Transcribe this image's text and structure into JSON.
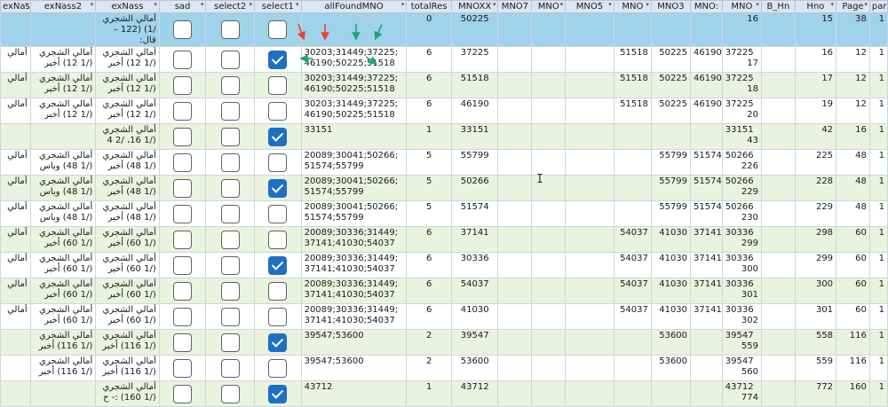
{
  "columns": {
    "exNass3": "exNass3",
    "exNass2": "exNass2",
    "exNass": "exNass",
    "sad": "sad",
    "select2": "select2",
    "select1": "select1",
    "allFoundMNO": "allFoundMNO",
    "totalRes": "totalRes",
    "MNOXX": "MNOXX",
    "MNO7": "MNO7",
    "MNO6": "MNO",
    "MNO5": "MNO5",
    "MNO4": "MNO",
    "MNO3": "MNO3",
    "MNO2": "MNO:",
    "MNO": "MNO",
    "B_Hno": "B_Hn",
    "Hno": "Hno",
    "Page": "Page",
    "part": "part"
  },
  "rows": [
    {
      "exNass3": "",
      "exNass2": "",
      "exNass": "أمالي الشجري /1) (122 – قال:",
      "sad": false,
      "select2": false,
      "select1": false,
      "allFoundMNO": "",
      "totalRes": "0",
      "MNOXX": "50225",
      "MNO7": "",
      "MNO6": "",
      "MNO5": "",
      "MNO4": "",
      "MNO3": "",
      "MNO2": "",
      "MNO": "",
      "B_Hno": "16",
      "Hno": "15",
      "Page": "38",
      "part": "1"
    },
    {
      "exNass3": "أمالي",
      "exNass2": "أمالي الشجري (/1 12) أخبر",
      "exNass": "أمالي الشجري (/1 12) أخبر",
      "sad": false,
      "select2": false,
      "select1": true,
      "allFoundMNO": "30203;31449;37225;46190;50225;51518",
      "totalRes": "6",
      "MNOXX": "37225",
      "MNO7": "",
      "MNO6": "",
      "MNO5": "",
      "MNO4": "51518",
      "MNO3": "50225",
      "MNO2": "46190",
      "MNO": "37225",
      "B_Hno": "17",
      "Hno": "16",
      "Page": "12",
      "part": "1"
    },
    {
      "exNass3": "أمالي",
      "exNass2": "أمالي الشجري (/1 12) أخبر",
      "exNass": "أمالي الشجري (/1 12) أخبر",
      "sad": false,
      "select2": false,
      "select1": false,
      "allFoundMNO": "30203;31449;37225;46190;50225;51518",
      "totalRes": "6",
      "MNOXX": "51518",
      "MNO7": "",
      "MNO6": "",
      "MNO5": "",
      "MNO4": "51518",
      "MNO3": "50225",
      "MNO2": "46190",
      "MNO": "37225",
      "B_Hno": "18",
      "Hno": "17",
      "Page": "12",
      "part": "1"
    },
    {
      "exNass3": "أمالي",
      "exNass2": "أمالي الشجري (/1 12) أخبر",
      "exNass": "أمالي الشجري (/1 12) أخبر",
      "sad": false,
      "select2": false,
      "select1": false,
      "allFoundMNO": "30203;31449;37225;46190;50225;51518",
      "totalRes": "6",
      "MNOXX": "46190",
      "MNO7": "",
      "MNO6": "",
      "MNO5": "",
      "MNO4": "51518",
      "MNO3": "50225",
      "MNO2": "46190",
      "MNO": "37225",
      "B_Hno": "20",
      "Hno": "19",
      "Page": "12",
      "part": "1"
    },
    {
      "exNass3": "",
      "exNass2": "",
      "exNass": "أمالي الشجري (/1 16، /2 4",
      "sad": false,
      "select2": false,
      "select1": true,
      "allFoundMNO": "33151",
      "totalRes": "1",
      "MNOXX": "33151",
      "MNO7": "",
      "MNO6": "",
      "MNO5": "",
      "MNO4": "",
      "MNO3": "",
      "MNO2": "",
      "MNO": "33151",
      "B_Hno": "43",
      "Hno": "42",
      "Page": "16",
      "part": "1"
    },
    {
      "exNass3": "أمالي",
      "exNass2": "أمالي الشجري (/1 48) وباس",
      "exNass": "أمالي الشجري (/1 48) أخبر",
      "sad": false,
      "select2": false,
      "select1": false,
      "allFoundMNO": "20089;30041;50266;51574;55799",
      "totalRes": "5",
      "MNOXX": "55799",
      "MNO7": "",
      "MNO6": "",
      "MNO5": "",
      "MNO4": "",
      "MNO3": "55799",
      "MNO2": "51574",
      "MNO": "50266",
      "B_Hno": "226",
      "Hno": "225",
      "Page": "48",
      "part": "1"
    },
    {
      "exNass3": "أمالي",
      "exNass2": "أمالي الشجري (/1 48) وباس",
      "exNass": "أمالي الشجري (/1 48) أخبر",
      "sad": false,
      "select2": false,
      "select1": true,
      "allFoundMNO": "20089;30041;50266;51574;55799",
      "totalRes": "5",
      "MNOXX": "50266",
      "MNO7": "",
      "MNO6": "",
      "MNO5": "",
      "MNO4": "",
      "MNO3": "55799",
      "MNO2": "51574",
      "MNO": "50266",
      "B_Hno": "229",
      "Hno": "228",
      "Page": "48",
      "part": "1"
    },
    {
      "exNass3": "أمالي",
      "exNass2": "أمالي الشجري (/1 48) وباس",
      "exNass": "أمالي الشجري (/1 48) أخبر",
      "sad": false,
      "select2": false,
      "select1": false,
      "allFoundMNO": "20089;30041;50266;51574;55799",
      "totalRes": "5",
      "MNOXX": "51574",
      "MNO7": "",
      "MNO6": "",
      "MNO5": "",
      "MNO4": "",
      "MNO3": "55799",
      "MNO2": "51574",
      "MNO": "50266",
      "B_Hno": "230",
      "Hno": "229",
      "Page": "48",
      "part": "1"
    },
    {
      "exNass3": "أمالي",
      "exNass2": "أمالي الشجري (/1 60) أخبر",
      "exNass": "أمالي الشجري (/1 60) أخبر",
      "sad": false,
      "select2": false,
      "select1": false,
      "allFoundMNO": "20089;30336;31449;37141;41030;54037",
      "totalRes": "6",
      "MNOXX": "37141",
      "MNO7": "",
      "MNO6": "",
      "MNO5": "",
      "MNO4": "54037",
      "MNO3": "41030",
      "MNO2": "37141",
      "MNO": "30336",
      "B_Hno": "299",
      "Hno": "298",
      "Page": "60",
      "part": "1"
    },
    {
      "exNass3": "أمالي",
      "exNass2": "أمالي الشجري (/1 60) أخبر",
      "exNass": "أمالي الشجري (/1 60) أخبر",
      "sad": false,
      "select2": false,
      "select1": true,
      "allFoundMNO": "20089;30336;31449;37141;41030;54037",
      "totalRes": "6",
      "MNOXX": "30336",
      "MNO7": "",
      "MNO6": "",
      "MNO5": "",
      "MNO4": "54037",
      "MNO3": "41030",
      "MNO2": "37141",
      "MNO": "30336",
      "B_Hno": "300",
      "Hno": "299",
      "Page": "60",
      "part": "1"
    },
    {
      "exNass3": "أمالي",
      "exNass2": "أمالي الشجري (/1 60) أخبر",
      "exNass": "أمالي الشجري (/1 60) أخبر",
      "sad": false,
      "select2": false,
      "select1": false,
      "allFoundMNO": "20089;30336;31449;37141;41030;54037",
      "totalRes": "6",
      "MNOXX": "54037",
      "MNO7": "",
      "MNO6": "",
      "MNO5": "",
      "MNO4": "54037",
      "MNO3": "41030",
      "MNO2": "37141",
      "MNO": "30336",
      "B_Hno": "301",
      "Hno": "300",
      "Page": "60",
      "part": "1"
    },
    {
      "exNass3": "أمالي",
      "exNass2": "أمالي الشجري (/1 60) أخبر",
      "exNass": "أمالي الشجري (/1 60) أخبر",
      "sad": false,
      "select2": false,
      "select1": false,
      "allFoundMNO": "20089;30336;31449;37141;41030;54037",
      "totalRes": "6",
      "MNOXX": "41030",
      "MNO7": "",
      "MNO6": "",
      "MNO5": "",
      "MNO4": "54037",
      "MNO3": "41030",
      "MNO2": "37141",
      "MNO": "30336",
      "B_Hno": "302",
      "Hno": "301",
      "Page": "60",
      "part": "1"
    },
    {
      "exNass3": "",
      "exNass2": "أمالي الشجري (/1 116) أخبر",
      "exNass": "أمالي الشجري (/1 116) أخبر",
      "sad": false,
      "select2": false,
      "select1": true,
      "allFoundMNO": "39547;53600",
      "totalRes": "2",
      "MNOXX": "39547",
      "MNO7": "",
      "MNO6": "",
      "MNO5": "",
      "MNO4": "",
      "MNO3": "53600",
      "MNO2": "",
      "MNO": "39547",
      "B_Hno": "559",
      "Hno": "558",
      "Page": "116",
      "part": "1"
    },
    {
      "exNass3": "",
      "exNass2": "أمالي الشجري (/1 116) أخبر",
      "exNass": "أمالي الشجري (/1 116) أخبر",
      "sad": false,
      "select2": false,
      "select1": false,
      "allFoundMNO": "39547;53600",
      "totalRes": "2",
      "MNOXX": "53600",
      "MNO7": "",
      "MNO6": "",
      "MNO5": "",
      "MNO4": "",
      "MNO3": "53600",
      "MNO2": "",
      "MNO": "39547",
      "B_Hno": "560",
      "Hno": "559",
      "Page": "116",
      "part": "1"
    },
    {
      "exNass3": "",
      "exNass2": "",
      "exNass": "أمالي الشجري (/1 160) :- ح",
      "sad": false,
      "select2": false,
      "select1": true,
      "allFoundMNO": "43712",
      "totalRes": "1",
      "MNOXX": "43712",
      "MNO7": "",
      "MNO6": "",
      "MNO5": "",
      "MNO4": "",
      "MNO3": "",
      "MNO2": "",
      "MNO": "43712",
      "B_Hno": "774",
      "Hno": "772",
      "Page": "160",
      "part": "1"
    }
  ],
  "colors": {
    "selected_row": "#9fd3ea",
    "alt_row": "#e9f3dd",
    "checkbox_on": "#1f6fc5",
    "header": "#dce6f1",
    "arrow_red": "#e8403c",
    "arrow_green": "#1fa37a"
  }
}
